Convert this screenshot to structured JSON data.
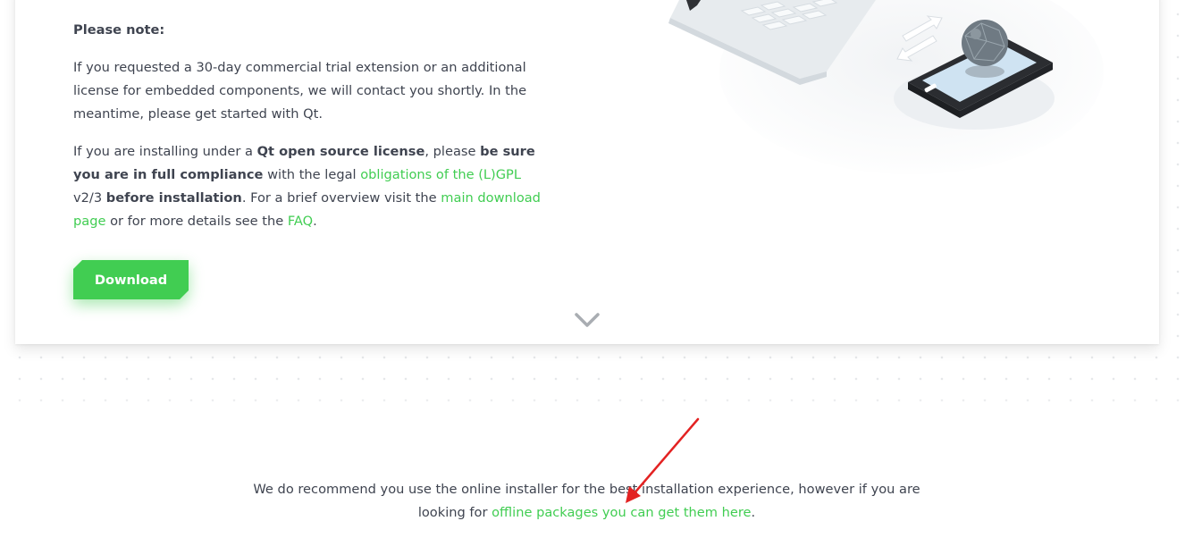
{
  "note": {
    "title": "Please note:",
    "p1": "If you requested a 30-day commercial trial extension or an additional license for embedded components, we will contact you shortly. In the meantime, please get started with Qt.",
    "p2": {
      "t1": "If you are installing under a ",
      "b1": "Qt open source license",
      "t2": ", please ",
      "b2": "be sure you are in full compliance",
      "t3": " with the legal ",
      "link1": "obligations of the (L)GPL",
      "t4": " v2/3 ",
      "b3": "before installation",
      "t5": ". For a brief overview visit the ",
      "link2": "main download page",
      "t6": " or for more details see the ",
      "link3": "FAQ",
      "t7": "."
    }
  },
  "download_label": "Download",
  "scroll_icon": "chevron-down-icon",
  "illustration_icon": "laptop-phone-sync-illustration",
  "bottom": {
    "t1": "We do recommend you use the online installer for the best installation experience, however if you are",
    "t2": "looking for ",
    "link": "offline packages you can get them here",
    "t3": "."
  },
  "colors": {
    "accent": "#41cd52",
    "text": "#3f4450",
    "annotation_arrow": "#e32222"
  }
}
